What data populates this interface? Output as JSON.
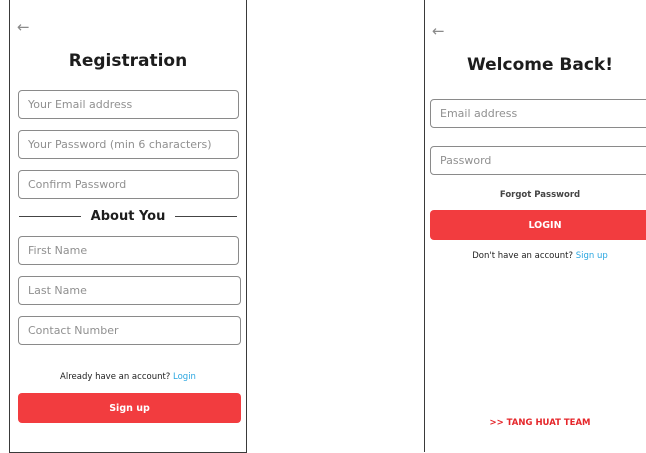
{
  "registration": {
    "back_icon": "arrow-left-icon",
    "title": "Registration",
    "fields": {
      "email": "Your Email address",
      "password": "Your Password (min 6 characters)",
      "confirm": "Confirm Password",
      "first_name": "First Name",
      "last_name": "Last Name",
      "contact": "Contact Number"
    },
    "section_label": "About You",
    "footer_prompt": "Already have an account?",
    "footer_link": "Login",
    "submit_label": "Sign up"
  },
  "login": {
    "back_icon": "arrow-left-icon",
    "title": "Welcome Back!",
    "fields": {
      "email": "Email address",
      "password": "Password"
    },
    "forgot_label": "Forgot Password",
    "submit_label": "LOGIN",
    "footer_prompt": "Don't have an account?",
    "footer_link": "Sign up",
    "team_label": ">> TANG HUAT TEAM"
  },
  "colors": {
    "accent": "#f23c3f",
    "link": "#2aa6e0",
    "team": "#e5262a"
  }
}
